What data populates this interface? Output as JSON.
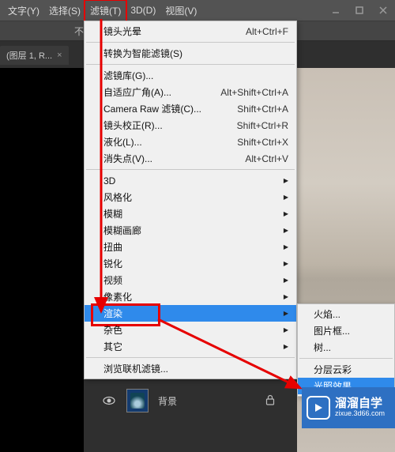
{
  "menubar": {
    "items": [
      "文字(Y)",
      "选择(S)",
      "滤镜(T)",
      "3D(D)",
      "视图(V)"
    ]
  },
  "subbar": {
    "text": "不"
  },
  "tab": {
    "label": "(图层 1, R...",
    "close": "×"
  },
  "dropdown": {
    "items": [
      {
        "label": "镜头光晕",
        "shortcut": "Alt+Ctrl+F"
      },
      {
        "sep": true
      },
      {
        "label": "转换为智能滤镜(S)"
      },
      {
        "sep": true
      },
      {
        "label": "滤镜库(G)..."
      },
      {
        "label": "自适应广角(A)...",
        "shortcut": "Alt+Shift+Ctrl+A"
      },
      {
        "label": "Camera Raw 滤镜(C)...",
        "shortcut": "Shift+Ctrl+A"
      },
      {
        "label": "镜头校正(R)...",
        "shortcut": "Shift+Ctrl+R"
      },
      {
        "label": "液化(L)...",
        "shortcut": "Shift+Ctrl+X"
      },
      {
        "label": "消失点(V)...",
        "shortcut": "Alt+Ctrl+V"
      },
      {
        "sep": true
      },
      {
        "label": "3D",
        "arrow": true
      },
      {
        "label": "风格化",
        "arrow": true
      },
      {
        "label": "模糊",
        "arrow": true
      },
      {
        "label": "模糊画廊",
        "arrow": true
      },
      {
        "label": "扭曲",
        "arrow": true
      },
      {
        "label": "锐化",
        "arrow": true
      },
      {
        "label": "视频",
        "arrow": true
      },
      {
        "label": "像素化",
        "arrow": true
      },
      {
        "label": "渲染",
        "arrow": true,
        "selected": true,
        "highlighted": true
      },
      {
        "label": "杂色",
        "arrow": true
      },
      {
        "label": "其它",
        "arrow": true
      },
      {
        "sep": true
      },
      {
        "label": "浏览联机滤镜..."
      }
    ]
  },
  "submenu": {
    "items": [
      {
        "label": "火焰..."
      },
      {
        "label": "图片框..."
      },
      {
        "label": "树..."
      },
      {
        "sep": true
      },
      {
        "label": "分层云彩"
      },
      {
        "label": "光照效果...",
        "highlighted": true
      }
    ]
  },
  "layers": {
    "name": "背景"
  },
  "watermark": {
    "main": "溜溜自学",
    "sub": "zixue.3d66.com"
  }
}
